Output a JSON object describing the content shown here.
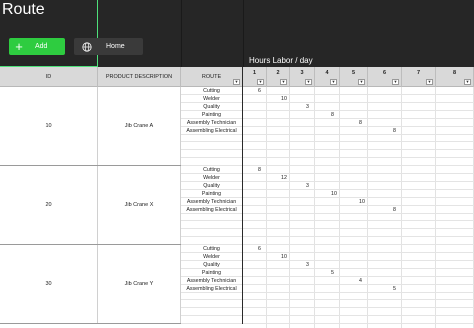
{
  "app": {
    "title": "Route"
  },
  "toolbar": {
    "add_label": "Add",
    "home_label": "Home",
    "hours_label": "Hours Labor / day"
  },
  "columns": {
    "id": "ID",
    "product": "PRODUCT DESCRIPTION",
    "route": "ROUTE",
    "days": [
      "1",
      "2",
      "3",
      "4",
      "5",
      "6",
      "7",
      "8"
    ]
  },
  "products": [
    {
      "id": "10",
      "name": "Jib Crane A",
      "steps": [
        {
          "route": "Cutting",
          "day": "1",
          "hours": "6"
        },
        {
          "route": "Welder",
          "day": "2",
          "hours": "10"
        },
        {
          "route": "Quality",
          "day": "3",
          "hours": "3"
        },
        {
          "route": "Painting",
          "day": "4",
          "hours": "8"
        },
        {
          "route": "Assembly Technician",
          "day": "5",
          "hours": "8"
        },
        {
          "route": "Assembling Electrical",
          "day": "6",
          "hours": "8"
        }
      ]
    },
    {
      "id": "20",
      "name": "Jib Crane X",
      "steps": [
        {
          "route": "Cutting",
          "day": "1",
          "hours": "8"
        },
        {
          "route": "Welder",
          "day": "2",
          "hours": "12"
        },
        {
          "route": "Quality",
          "day": "3",
          "hours": "3"
        },
        {
          "route": "Painting",
          "day": "4",
          "hours": "10"
        },
        {
          "route": "Assembly Technician",
          "day": "5",
          "hours": "10"
        },
        {
          "route": "Assembling Electrical",
          "day": "6",
          "hours": "8"
        }
      ]
    },
    {
      "id": "30",
      "name": "Jib Crane Y",
      "steps": [
        {
          "route": "Cutting",
          "day": "1",
          "hours": "6"
        },
        {
          "route": "Welder",
          "day": "2",
          "hours": "10"
        },
        {
          "route": "Quality",
          "day": "3",
          "hours": "3"
        },
        {
          "route": "Painting",
          "day": "4",
          "hours": "5"
        },
        {
          "route": "Assembly Technician",
          "day": "5",
          "hours": "4"
        },
        {
          "route": "Assembling Electrical",
          "day": "6",
          "hours": "5"
        }
      ]
    }
  ]
}
